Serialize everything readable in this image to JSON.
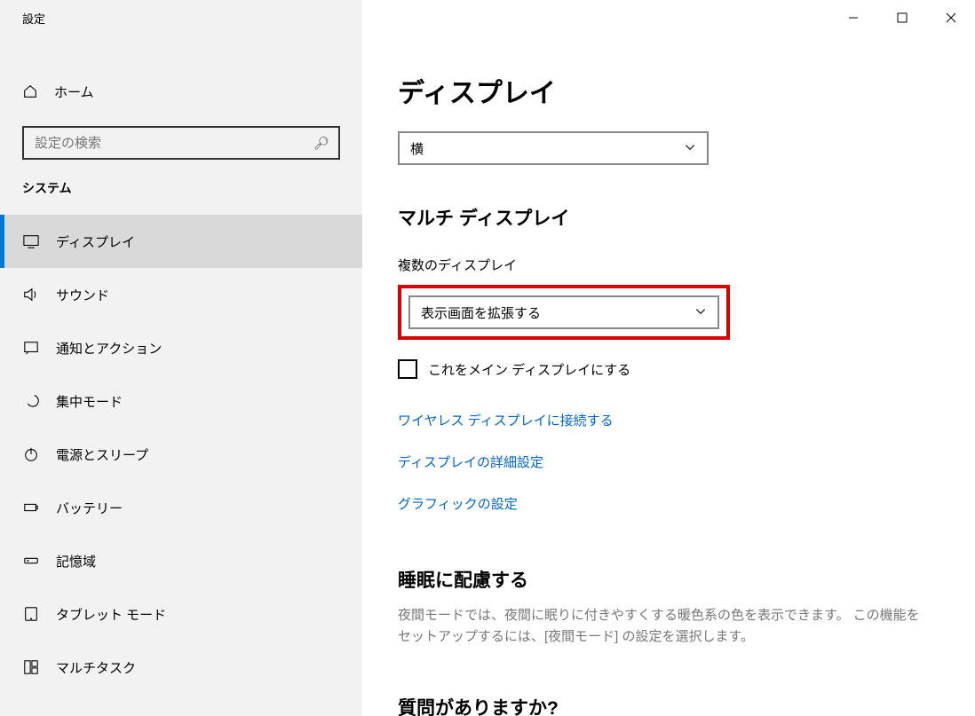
{
  "window": {
    "title": "設定"
  },
  "home": {
    "label": "ホーム"
  },
  "search": {
    "placeholder": "設定の検索"
  },
  "category": {
    "label": "システム"
  },
  "nav": {
    "items": [
      {
        "label": "ディスプレイ"
      },
      {
        "label": "サウンド"
      },
      {
        "label": "通知とアクション"
      },
      {
        "label": "集中モード"
      },
      {
        "label": "電源とスリープ"
      },
      {
        "label": "バッテリー"
      },
      {
        "label": "記憶域"
      },
      {
        "label": "タブレット モード"
      },
      {
        "label": "マルチタスク"
      }
    ]
  },
  "page": {
    "title": "ディスプレイ"
  },
  "orientation": {
    "value": "横"
  },
  "multi": {
    "heading": "マルチ ディスプレイ",
    "field_label": "複数のディスプレイ",
    "dropdown_value": "表示画面を拡張する",
    "checkbox_label": "これをメイン ディスプレイにする"
  },
  "links": {
    "wireless": "ワイヤレス ディスプレイに接続する",
    "advanced": "ディスプレイの詳細設定",
    "graphics": "グラフィックの設定"
  },
  "sleep": {
    "heading": "睡眠に配慮する",
    "desc": "夜間モードでは、夜間に眠りに付きやすくする暖色系の色を表示できます。 この機能をセットアップするには、[夜間モード] の設定を選択します。"
  },
  "question": {
    "heading": "質問がありますか?"
  }
}
